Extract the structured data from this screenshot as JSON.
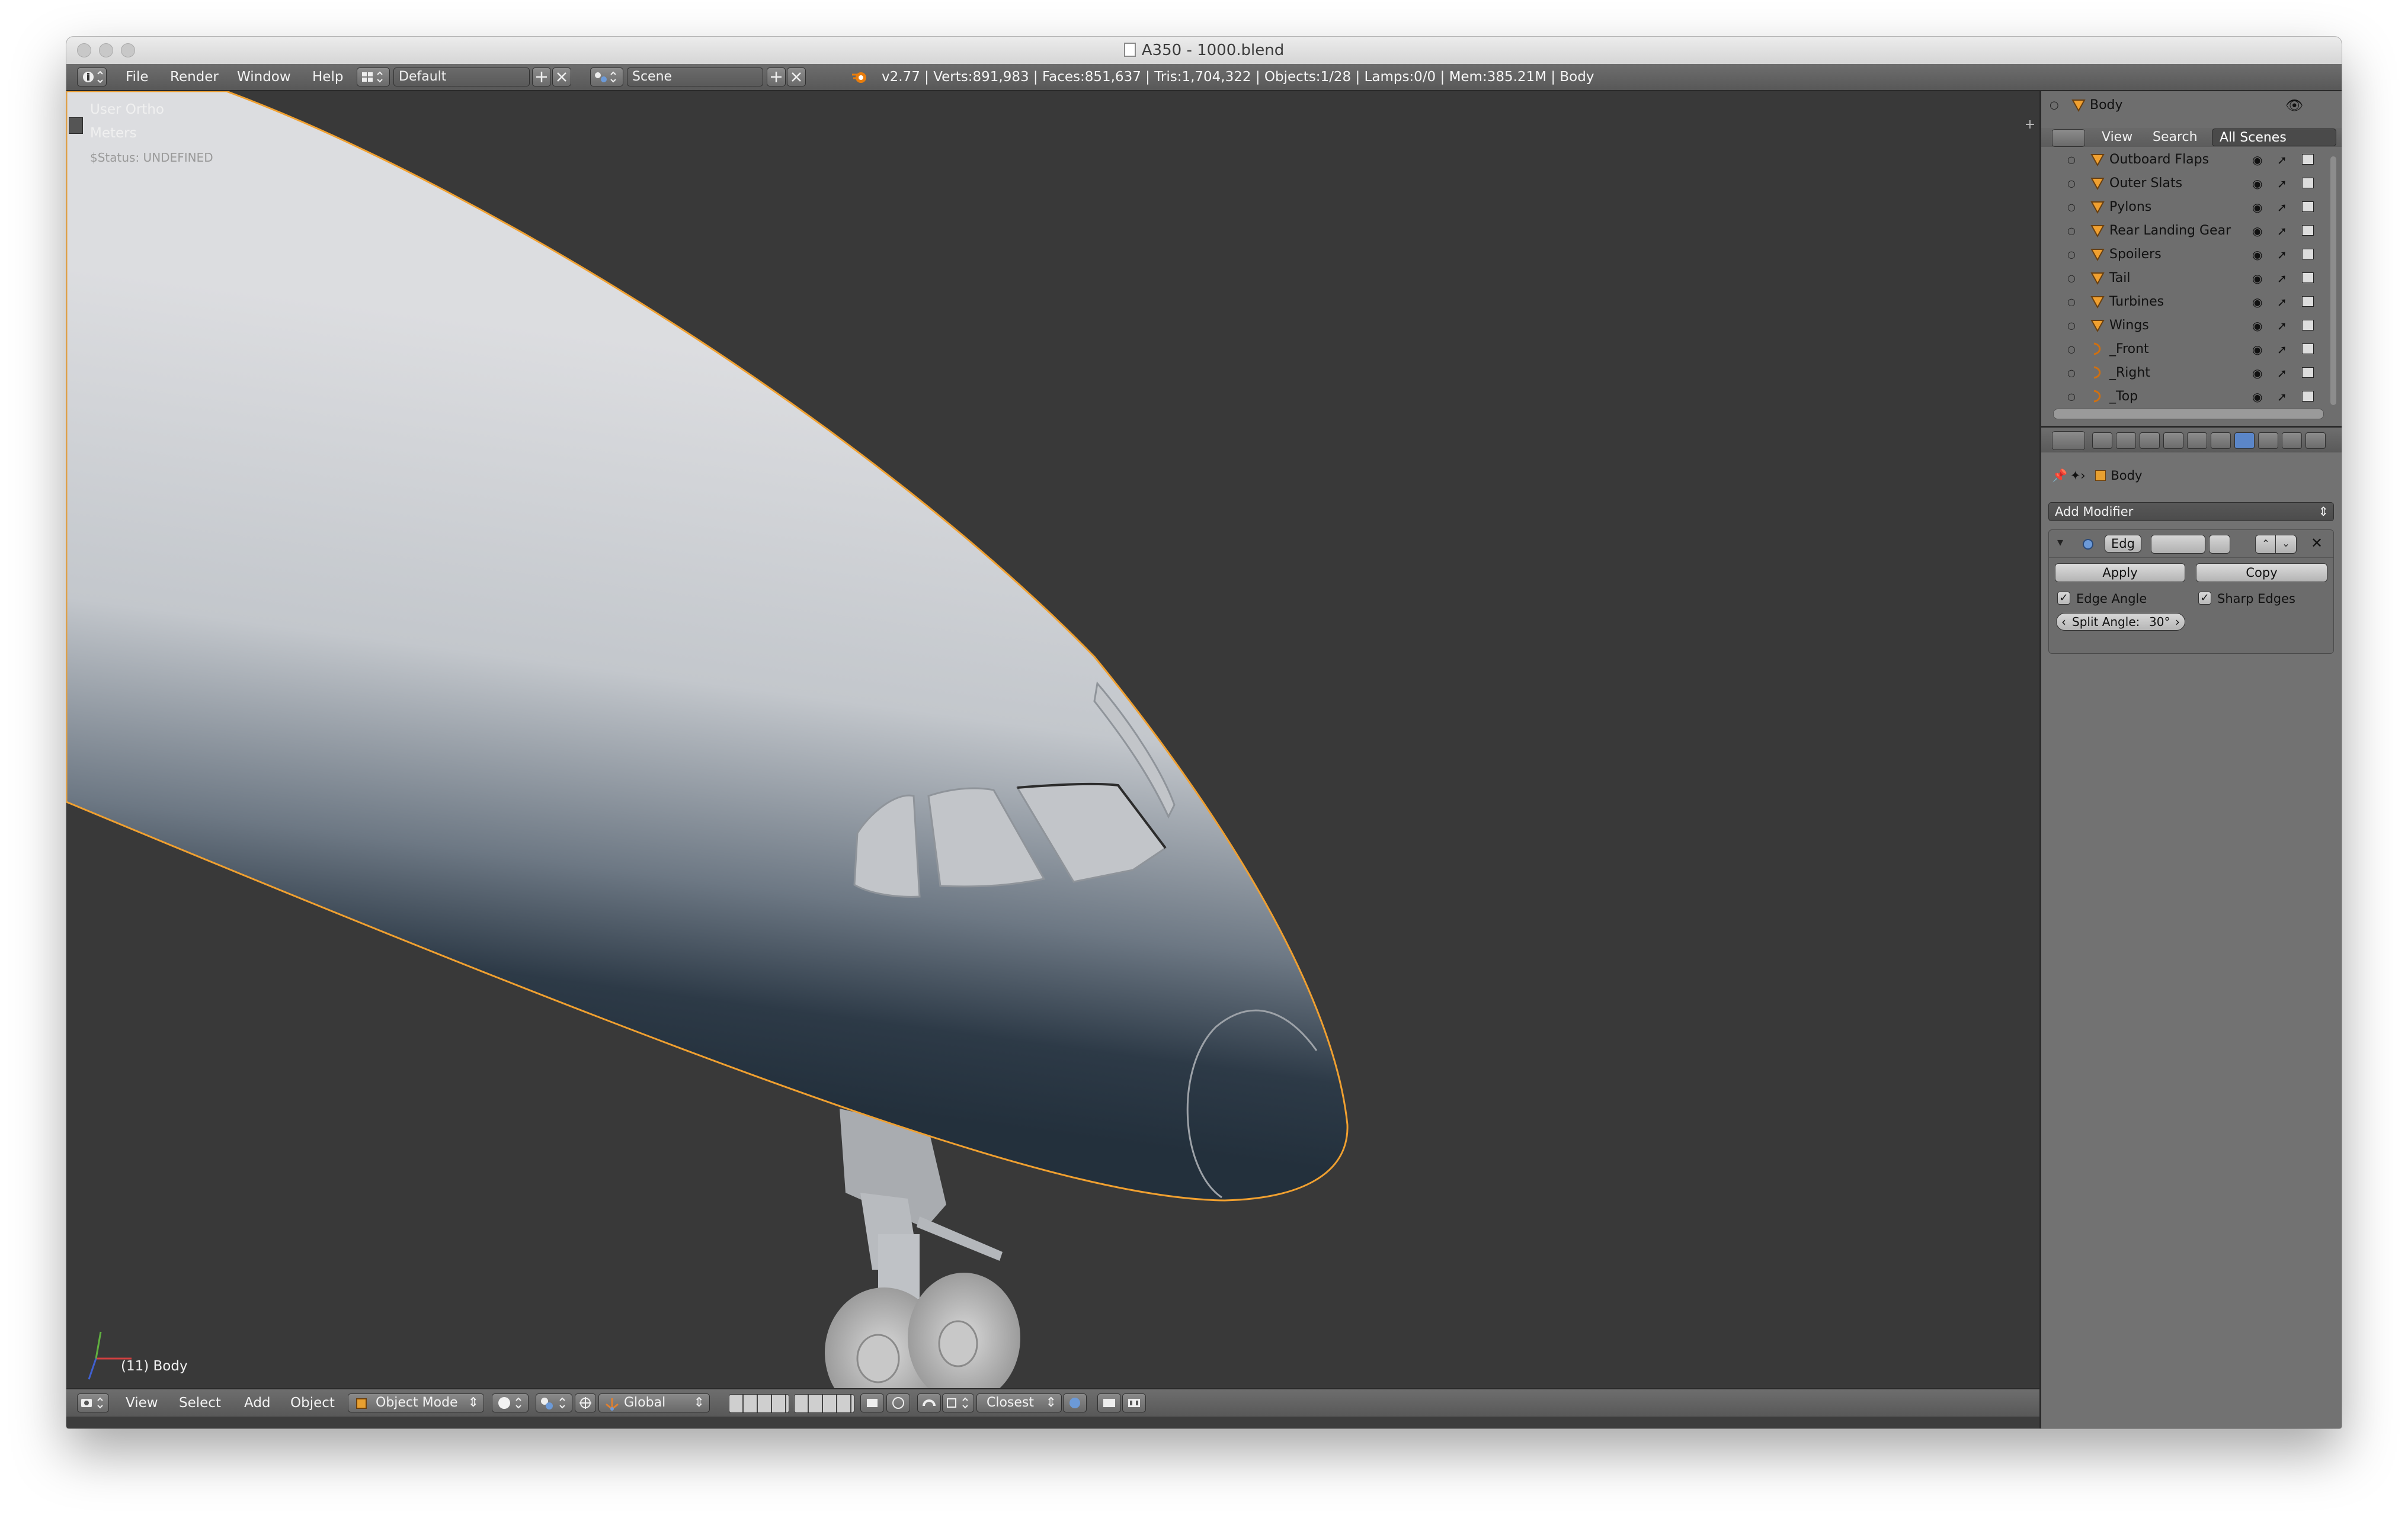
{
  "window": {
    "title": "A350 - 1000.blend"
  },
  "info_header": {
    "menus": [
      "File",
      "Render",
      "Window",
      "Help"
    ],
    "screen_layout": "Default",
    "scene": "Scene",
    "stats": "v2.77 | Verts:891,983 | Faces:851,637 | Tris:1,704,322 | Objects:1/28 | Lamps:0/0 | Mem:385.21M | Body"
  },
  "viewport": {
    "view_name": "User Ortho",
    "units": "Meters",
    "status": "$Status: UNDEFINED",
    "active_object_label": "(11) Body"
  },
  "view3d_header": {
    "menus": [
      "View",
      "Select",
      "Add",
      "Object"
    ],
    "mode": "Object Mode",
    "orientation": "Global",
    "snap_target": "Closest"
  },
  "outliner": {
    "header_object": "Body",
    "tabs": [
      "View",
      "Search",
      "All Scenes"
    ],
    "items": [
      {
        "name": "Outboard Flaps",
        "kind": "mesh"
      },
      {
        "name": "Outer Slats",
        "kind": "mesh"
      },
      {
        "name": "Pylons",
        "kind": "mesh"
      },
      {
        "name": "Rear Landing Gear",
        "kind": "mesh"
      },
      {
        "name": "Spoilers",
        "kind": "mesh"
      },
      {
        "name": "Tail",
        "kind": "mesh"
      },
      {
        "name": "Turbines",
        "kind": "mesh"
      },
      {
        "name": "Wings",
        "kind": "mesh"
      },
      {
        "name": "_Front",
        "kind": "camera"
      },
      {
        "name": "_Right",
        "kind": "camera"
      },
      {
        "name": "_Top",
        "kind": "camera"
      }
    ]
  },
  "properties": {
    "context_object": "Body",
    "add_modifier": "Add Modifier",
    "modifier_name": "Edg",
    "apply": "Apply",
    "copy": "Copy",
    "edge_angle": "Edge Angle",
    "sharp_edges": "Sharp Edges",
    "split_angle_label": "Split Angle:",
    "split_angle_value": "30°"
  },
  "colors": {
    "selection_outline": "#f0a030",
    "viewport_bg": "#393939",
    "panel_bg": "#727272"
  }
}
